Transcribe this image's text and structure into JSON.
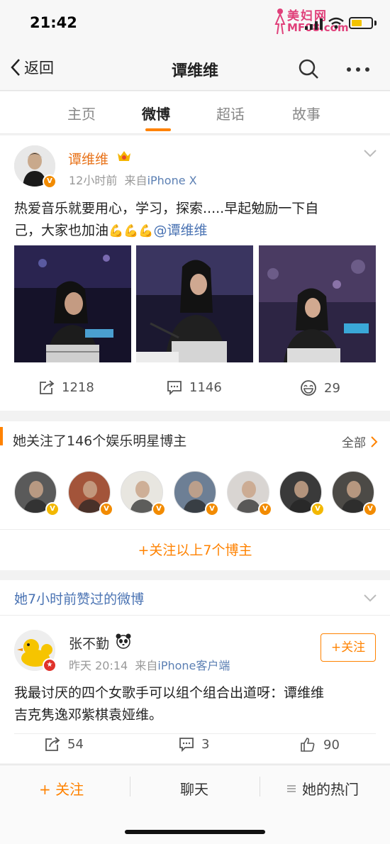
{
  "status": {
    "time": "21:42",
    "watermark_line1": "美妇网",
    "watermark_line2": "MF08.com"
  },
  "nav": {
    "back_label": "返回",
    "title": "谭维维"
  },
  "tabs": [
    {
      "label": "主页",
      "active": false
    },
    {
      "label": "微博",
      "active": true
    },
    {
      "label": "超话",
      "active": false
    },
    {
      "label": "故事",
      "active": false
    }
  ],
  "post1": {
    "username": "谭维维",
    "time": "12小时前",
    "from_prefix": "来自",
    "source": "iPhone X",
    "text_line1": "热爱音乐就要用心，学习，探索.....早起勉励一下自",
    "text_line2_prefix": "己，大家也加油",
    "emoji": "💪💪💪",
    "mention": "@谭维维",
    "reposts": "1218",
    "comments": "1146",
    "likes": "29"
  },
  "following": {
    "title": "她关注了146个娱乐明星博主",
    "all_label": "全部",
    "follow_all_label": "+关注以上7个博主",
    "avatars": [
      {
        "badge": "gold",
        "tone": "#5a5a5a"
      },
      {
        "badge": "orange",
        "tone": "#a3543a"
      },
      {
        "badge": "orange",
        "tone": "#e8e6e0"
      },
      {
        "badge": "orange",
        "tone": "#6d7f95"
      },
      {
        "badge": "orange",
        "tone": "#d9d5d2"
      },
      {
        "badge": "gold",
        "tone": "#3a3a3a"
      },
      {
        "badge": "orange",
        "tone": "#4c4a46"
      }
    ]
  },
  "liked": {
    "title": "她7小时前赞过的微博",
    "username": "张不勤",
    "time": "昨天 20:14",
    "from_prefix": "来自",
    "source": "iPhone客户端",
    "follow_label": "+关注",
    "text_line1": "我最讨厌的四个女歌手可以组个组合出道呀：谭维维",
    "text_line2": "吉克隽逸邓紫棋袁娅维。",
    "reposts": "54",
    "comments": "3",
    "likes": "90"
  },
  "bottombar": {
    "follow": "+ 关注",
    "chat": "聊天",
    "hot": "她的热门"
  },
  "colors": {
    "accent": "#ff8200",
    "link": "#4a73b3",
    "username_orange": "#e8731a"
  }
}
